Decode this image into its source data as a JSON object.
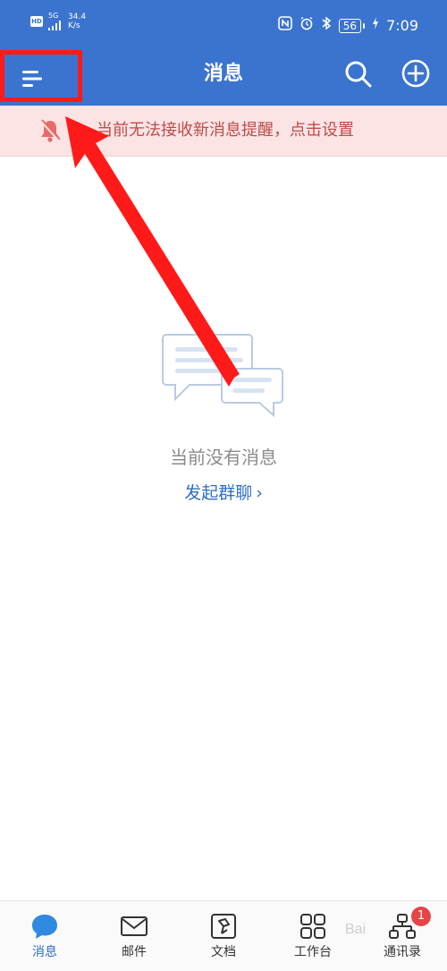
{
  "status_bar": {
    "hd": "HD",
    "network": "5G",
    "speed_value": "34.4",
    "speed_unit": "K/s",
    "battery": "56",
    "time": "7:09"
  },
  "header": {
    "title": "消息"
  },
  "notice": {
    "text": "当前无法接收新消息提醒，点击设置"
  },
  "empty_state": {
    "message": "当前没有消息",
    "action": "发起群聊",
    "action_chevron": "›"
  },
  "bottom_nav": {
    "items": [
      {
        "label": "消息",
        "active": true
      },
      {
        "label": "邮件",
        "active": false
      },
      {
        "label": "文档",
        "active": false
      },
      {
        "label": "工作台",
        "active": false
      },
      {
        "label": "通讯录",
        "active": false,
        "badge": "1"
      }
    ]
  },
  "watermark": "Bai",
  "colors": {
    "primary": "#3a74cf",
    "notice_bg": "#fce4e4",
    "notice_text": "#c04a4a",
    "link": "#2f6fc2",
    "badge": "#e64545",
    "annotation": "#ff1a1a"
  },
  "icons": [
    "menu-icon",
    "search-icon",
    "add-icon",
    "bell-off-icon",
    "chat-bubbles-icon",
    "message-icon",
    "mail-icon",
    "document-icon",
    "grid-icon",
    "contacts-icon"
  ]
}
